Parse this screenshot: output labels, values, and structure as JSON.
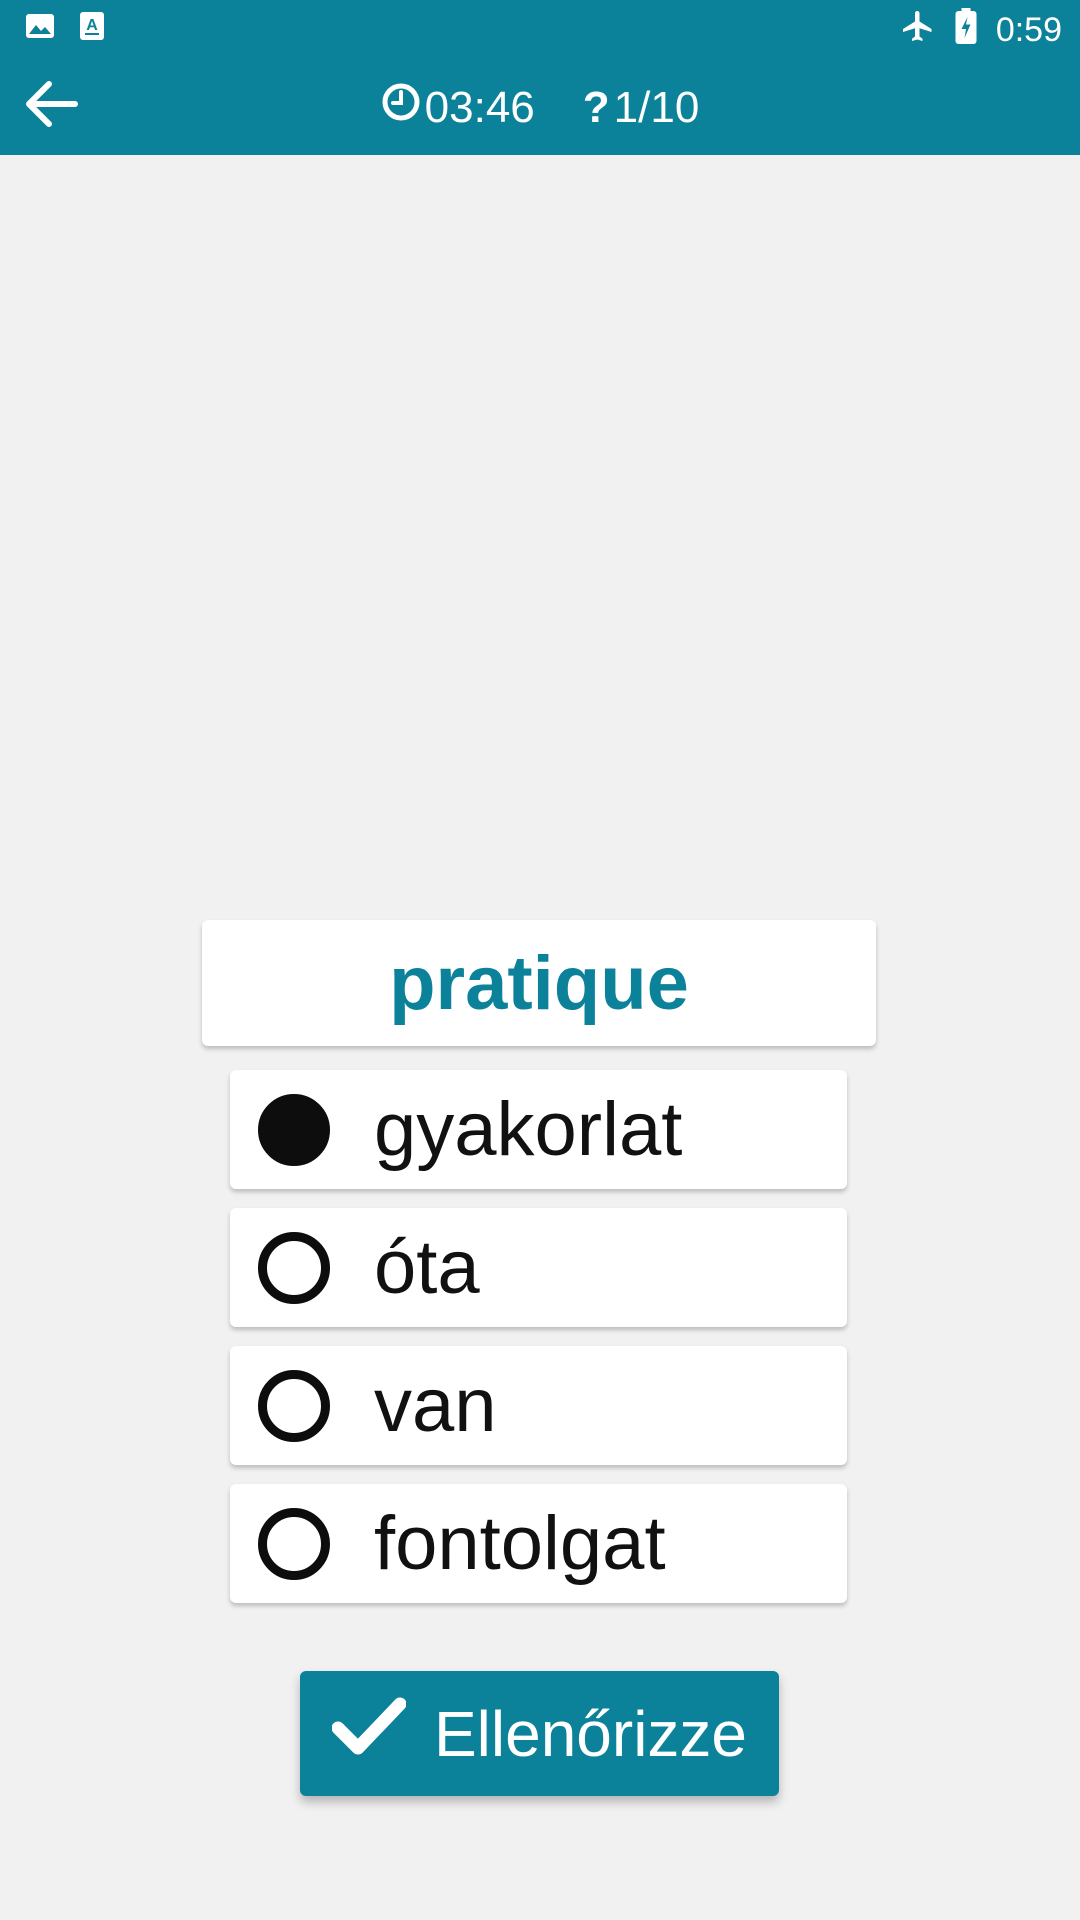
{
  "status_bar": {
    "time": "0:59",
    "icons": [
      "image-icon",
      "font-icon",
      "airplane-icon",
      "battery-charging-icon"
    ]
  },
  "app_bar": {
    "back_icon": "arrow-left-icon",
    "timer_icon": "clock-icon",
    "timer": "03:46",
    "question_icon": "question-icon",
    "question_counter": "1/10"
  },
  "quiz": {
    "word": "pratique",
    "options": [
      {
        "label": "gyakorlat",
        "selected": true
      },
      {
        "label": "óta",
        "selected": false
      },
      {
        "label": "van",
        "selected": false
      },
      {
        "label": "fontolgat",
        "selected": false
      }
    ],
    "check_label": "Ellenőrizze",
    "check_icon": "checkmark-icon"
  },
  "colors": {
    "primary": "#0b8299",
    "background": "#f1f1f1",
    "card": "#ffffff"
  }
}
